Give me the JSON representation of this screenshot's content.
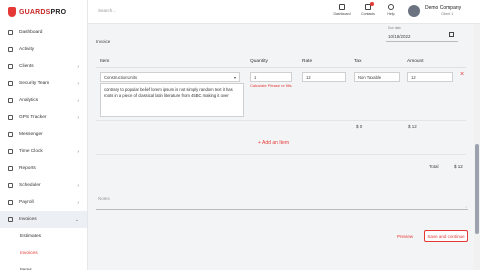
{
  "sidebar": {
    "logo": {
      "part1": "GUARDS",
      "part2": "PRO"
    },
    "items": [
      {
        "label": "Dashboard",
        "icon": "dashboard-icon",
        "chevron": ""
      },
      {
        "label": "Activity",
        "icon": "activity-icon",
        "chevron": ""
      },
      {
        "label": "Clients",
        "icon": "clients-icon",
        "chevron": "›"
      },
      {
        "label": "Security Team",
        "icon": "security-team-icon",
        "chevron": "›"
      },
      {
        "label": "Analytics",
        "icon": "analytics-icon",
        "chevron": "›"
      },
      {
        "label": "GPS Tracker",
        "icon": "gps-icon",
        "chevron": "›"
      },
      {
        "label": "Messenger",
        "icon": "messenger-icon",
        "chevron": ""
      },
      {
        "label": "Time Clock",
        "icon": "time-clock-icon",
        "chevron": "›"
      },
      {
        "label": "Reports",
        "icon": "reports-icon",
        "chevron": ""
      },
      {
        "label": "Scheduler",
        "icon": "scheduler-icon",
        "chevron": "›"
      },
      {
        "label": "Payroll",
        "icon": "payroll-icon",
        "chevron": "›"
      },
      {
        "label": "Invoices",
        "icon": "invoices-icon",
        "chevron": "⌄"
      }
    ],
    "sub_items": [
      {
        "label": "Estimates"
      },
      {
        "label": "Invoices"
      },
      {
        "label": "Items"
      }
    ]
  },
  "header": {
    "search_placeholder": "Search...",
    "icons": [
      {
        "label": "Dashboard",
        "icon": "dashboard-icon"
      },
      {
        "label": "Contacts",
        "icon": "contacts-icon"
      },
      {
        "label": "Help",
        "icon": "help-icon"
      }
    ],
    "company": "Demo Company",
    "role": "Client 1"
  },
  "form": {
    "date_label": "Due date",
    "date_value": "10/18/2022",
    "invoice_label": "Invoice",
    "columns": [
      "Item",
      "Quantity",
      "Rate",
      "Tax",
      "Amount"
    ],
    "line": {
      "product": "ConstructionUnits",
      "description": "contrary to popular belief lorem ipsum is not simply random text it has roots in a piece of classical latin literature from 45BC making it over",
      "quantity": "1",
      "quantity_error": "Calculate Please re fills",
      "rate": "12",
      "tax": "Non Taxable",
      "amount": "12"
    },
    "subtotals": {
      "tax": "$ 0",
      "amount": "$ 12"
    },
    "add_line": "+ Add an Item",
    "total_label": "Total",
    "total_value": "$ 12",
    "notes_placeholder": "Notes",
    "preview_label": "Preview",
    "save_label": "Save and continue"
  },
  "colors": {
    "accent": "#e53935"
  }
}
